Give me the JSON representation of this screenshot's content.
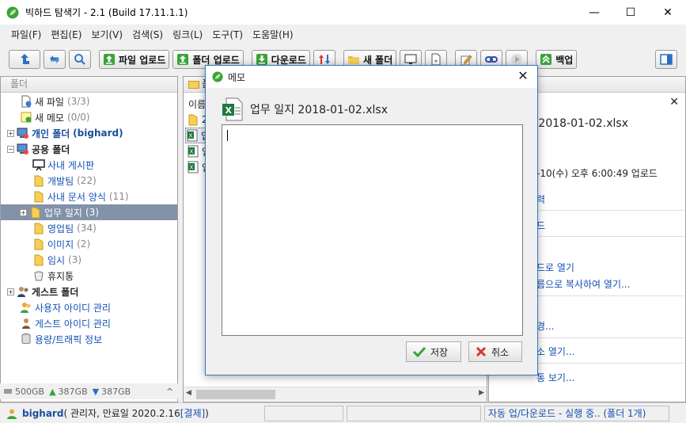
{
  "window": {
    "title": "빅하드 탐색기 - 2.1 (Build 17.11.1.1)",
    "controls": {
      "minimize": "—",
      "maximize": "☐",
      "close": "✕"
    }
  },
  "menu": [
    "파일(F)",
    "편집(E)",
    "보기(V)",
    "검색(S)",
    "링크(L)",
    "도구(T)",
    "도움말(H)"
  ],
  "toolbar": {
    "upload_file": "파일 업로드",
    "upload_folder": "폴더 업로드",
    "download": "다운로드",
    "new_folder": "새 폴더",
    "backup": "백업"
  },
  "left_panel": {
    "header": "폴더",
    "items": [
      {
        "label": "새 파일",
        "count": "(3/3)"
      },
      {
        "label": "새 메모",
        "count": "(0/0)"
      },
      {
        "label": "개인 폴더",
        "extra": "(bighard)"
      },
      {
        "label": "공용 폴더"
      },
      {
        "label": "사내 게시판"
      },
      {
        "label": "개발팀",
        "count": "(22)"
      },
      {
        "label": "사내 문서 양식",
        "count": "(11)"
      },
      {
        "label": "업무 일지",
        "count": "(3)"
      },
      {
        "label": "영업팀",
        "count": "(34)"
      },
      {
        "label": "이미지",
        "count": "(2)"
      },
      {
        "label": "임시",
        "count": "(3)"
      },
      {
        "label": "휴지통"
      },
      {
        "label": "게스트 폴더"
      },
      {
        "label": "사용자 아이디 관리"
      },
      {
        "label": "게스트 아이디 관리"
      },
      {
        "label": "용량/트래픽 정보"
      }
    ],
    "storage": {
      "total": "500GB",
      "up": "387GB",
      "down": "387GB"
    }
  },
  "mid_panel": {
    "header": "폴",
    "column": "이름",
    "rows": [
      "2",
      "업",
      "업",
      "업"
    ]
  },
  "right_panel": {
    "title": "업무 일지 2018-01-02.xlsx",
    "upload_info": "-10(수) 오후 6:00:49 업로드",
    "links": [
      "력",
      "드",
      "드로 열기",
      "름으로 복사하여 열기...",
      "경...",
      "소 열기...",
      "통 보기..."
    ]
  },
  "status": {
    "user": "bighard",
    "info": "( 관리자, 만료일 2020.2.16 ",
    "payment": "[결제]",
    "info_end": " )",
    "transfer": "자동 업/다운로드 - 실행 중.. (폴더 1개)"
  },
  "dialog": {
    "title": "메모",
    "file_name": "업무 일지 2018-01-02.xlsx",
    "memo_value": "",
    "save": "저장",
    "cancel": "취소"
  }
}
